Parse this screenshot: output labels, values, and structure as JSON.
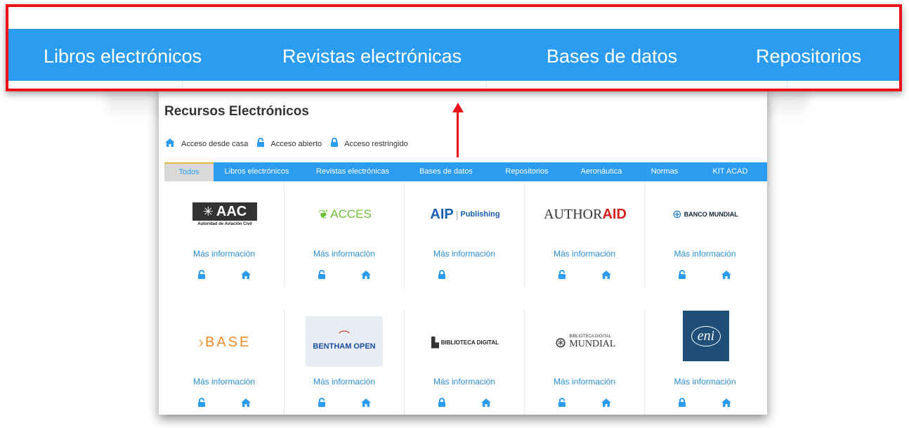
{
  "zoom_nav": {
    "items": [
      "Libros electrónicos",
      "Revistas electrónicas",
      "Bases de datos",
      "Repositorios"
    ]
  },
  "panel": {
    "title": "Recursos Electrónicos",
    "legend": {
      "home": "Acceso desde casa",
      "open": "Acceso abierto",
      "restricted": "Acceso restringido"
    },
    "tabs": [
      "Todos",
      "Libros electrónicos",
      "Revistas electrónicas",
      "Bases de datos",
      "Repositorios",
      "Aeronáutica",
      "Normas",
      "KIT ACAD"
    ],
    "active_tab": "Todos",
    "more_label": "Más información",
    "resources": [
      {
        "name": "AAC",
        "logo_text": "AAC",
        "logo_sub": "Autoridad de Aviación Civil",
        "access": "open",
        "home": true
      },
      {
        "name": "ACCES",
        "logo_text": "ACCES",
        "access": "open",
        "home": true
      },
      {
        "name": "AIP Publishing",
        "logo_text": "AIP",
        "logo_sub": "Publishing",
        "access": "restricted",
        "home": false
      },
      {
        "name": "AuthorAID",
        "logo_text": "AUTHOR",
        "logo_sub": "AID",
        "access": "open",
        "home": true
      },
      {
        "name": "Banco Mundial",
        "logo_text": "BANCO MUNDIAL",
        "access": "open",
        "home": true
      },
      {
        "name": "BASE",
        "logo_text": "BASE",
        "access": "open",
        "home": true
      },
      {
        "name": "Bentham Open",
        "logo_text": "BENTHAM OPEN",
        "access": "open",
        "home": true
      },
      {
        "name": "Biblioteca Digital",
        "logo_text": "BIBLIOTECA DIGITAL",
        "access": "restricted",
        "home": true
      },
      {
        "name": "Biblioteca Digital Mundial",
        "logo_text": "BIBLIOTECA DIGITAL",
        "logo_sub": "MUNDIAL",
        "access": "open",
        "home": true
      },
      {
        "name": "ENI",
        "logo_text": "eni",
        "access": "restricted",
        "home": true
      }
    ]
  },
  "colors": {
    "nav_blue": "#2b9cf0",
    "link_blue": "#2b8fd6",
    "highlight_red": "#e8141b",
    "active_tab_accent": "#e7b93d"
  }
}
